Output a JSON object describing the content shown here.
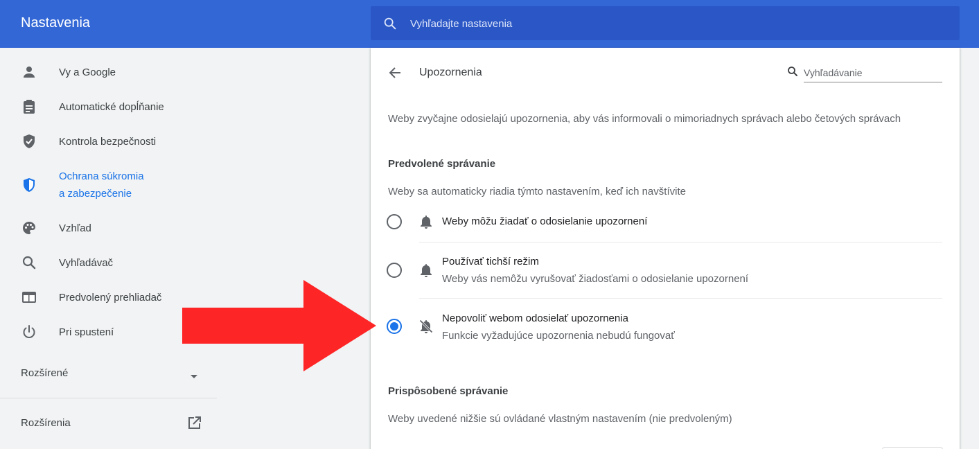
{
  "header": {
    "title": "Nastavenia",
    "search_placeholder": "Vyhľadajte nastavenia",
    "search_icon": "search-icon",
    "colors": {
      "bar": "#3367d6",
      "search_bg": "#2a56c6"
    }
  },
  "sidebar": {
    "items": [
      {
        "label": "Vy a Google",
        "icon": "person-icon"
      },
      {
        "label": "Automatické dopĺňanie",
        "icon": "clipboard-icon"
      },
      {
        "label": "Kontrola bezpečnosti",
        "icon": "shield-check-icon"
      },
      {
        "label_line1": "Ochrana súkromia",
        "label_line2": "a zabezpečenie",
        "icon": "shield-icon",
        "active": true
      },
      {
        "label": "Vzhľad",
        "icon": "palette-icon"
      },
      {
        "label": "Vyhľadávač",
        "icon": "search-icon"
      },
      {
        "label": "Predvolený prehliadač",
        "icon": "browser-icon"
      },
      {
        "label": "Pri spustení",
        "icon": "power-icon"
      }
    ],
    "advanced_label": "Rozšírené",
    "extensions_label": "Rozšírenia",
    "active_color": "#1a73e8"
  },
  "content": {
    "title": "Upozornenia",
    "search_placeholder": "Vyhľadávanie",
    "intro": "Weby zvyčajne odosielajú upozornenia, aby vás informovali o mimoriadnych správach alebo četových správach",
    "default_section": {
      "title": "Predvolené správanie",
      "description": "Weby sa automaticky riadia týmto nastavením, keď ich navštívite",
      "options": [
        {
          "label": "Weby môžu žiadať o odosielanie upozornení",
          "sub": "",
          "icon": "bell-icon",
          "selected": false
        },
        {
          "label": "Používať tichší režim",
          "sub": "Weby vás nemôžu vyrušovať žiadosťami o odosielanie upozornení",
          "icon": "bell-icon",
          "selected": false
        },
        {
          "label": "Nepovoliť webom odosielať upozornenia",
          "sub": "Funkcie vyžadujúce upozornenia nebudú fungovať",
          "icon": "bell-off-icon",
          "selected": true
        }
      ]
    },
    "custom_section": {
      "title": "Prispôsobené správanie",
      "description": "Weby uvedené nižšie sú ovládané vlastným nastavením (nie predvoleným)"
    }
  },
  "annotation": {
    "icon": "red-arrow-icon",
    "color": "#fe2526"
  }
}
